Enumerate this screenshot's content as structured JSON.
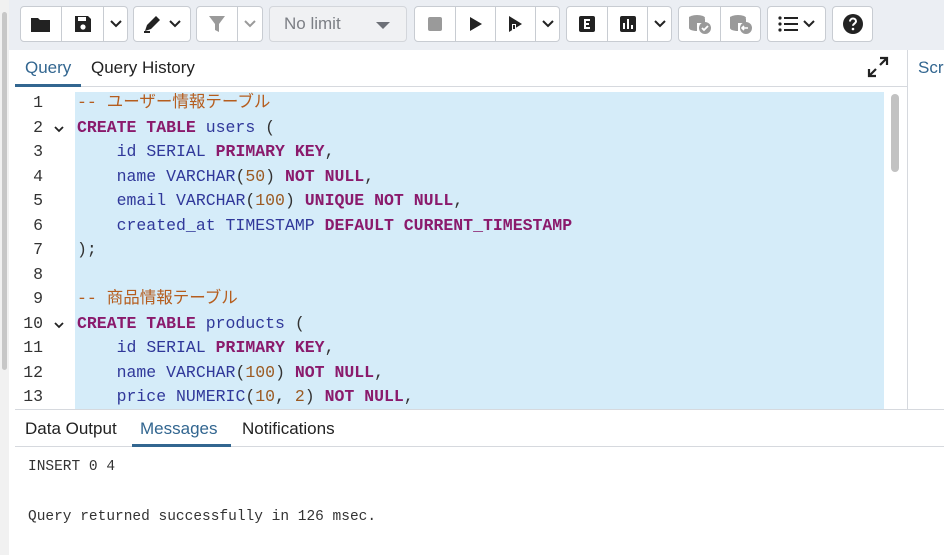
{
  "toolbar": {
    "limit_select": "No limit",
    "icons": [
      "folder-open-icon",
      "save-icon",
      "chevron-down-icon",
      "pen-icon",
      "filter-icon",
      "stop-icon",
      "play-icon",
      "play-step-icon",
      "explain-icon",
      "explain-analyze-icon",
      "commit-icon",
      "rollback-icon",
      "macros-icon",
      "help-icon"
    ]
  },
  "query_tabs": [
    {
      "label": "Query",
      "active": true
    },
    {
      "label": "Query History",
      "active": false
    }
  ],
  "right_panel_label": "Scr",
  "editor": {
    "line_numbers": [
      "1",
      "2",
      "3",
      "4",
      "5",
      "6",
      "7",
      "8",
      "9",
      "10",
      "11",
      "12",
      "13"
    ],
    "lines": [
      {
        "segments": [
          {
            "t": "-- ユーザー情報テーブル",
            "c": "cm"
          }
        ]
      },
      {
        "segments": [
          {
            "t": "CREATE TABLE",
            "c": "kw"
          },
          {
            "t": " users ",
            "c": "id"
          },
          {
            "t": "(",
            "c": "pn"
          }
        ]
      },
      {
        "segments": [
          {
            "t": "    id ",
            "c": "id"
          },
          {
            "t": "SERIAL",
            "c": "tp"
          },
          {
            "t": " ",
            "c": "pn"
          },
          {
            "t": "PRIMARY KEY",
            "c": "kw"
          },
          {
            "t": ",",
            "c": "pn"
          }
        ]
      },
      {
        "segments": [
          {
            "t": "    name ",
            "c": "id"
          },
          {
            "t": "VARCHAR",
            "c": "tp"
          },
          {
            "t": "(",
            "c": "pn"
          },
          {
            "t": "50",
            "c": "num"
          },
          {
            "t": ") ",
            "c": "pn"
          },
          {
            "t": "NOT NULL",
            "c": "kw"
          },
          {
            "t": ",",
            "c": "pn"
          }
        ]
      },
      {
        "segments": [
          {
            "t": "    email ",
            "c": "id"
          },
          {
            "t": "VARCHAR",
            "c": "tp"
          },
          {
            "t": "(",
            "c": "pn"
          },
          {
            "t": "100",
            "c": "num"
          },
          {
            "t": ") ",
            "c": "pn"
          },
          {
            "t": "UNIQUE NOT NULL",
            "c": "kw"
          },
          {
            "t": ",",
            "c": "pn"
          }
        ]
      },
      {
        "segments": [
          {
            "t": "    created_at ",
            "c": "id"
          },
          {
            "t": "TIMESTAMP",
            "c": "tp"
          },
          {
            "t": " ",
            "c": "pn"
          },
          {
            "t": "DEFAULT CURRENT_TIMESTAMP",
            "c": "kw"
          }
        ]
      },
      {
        "segments": [
          {
            "t": ");",
            "c": "pn"
          }
        ]
      },
      {
        "segments": [
          {
            "t": "",
            "c": "pn"
          }
        ]
      },
      {
        "segments": [
          {
            "t": "-- 商品情報テーブル",
            "c": "cm"
          }
        ]
      },
      {
        "segments": [
          {
            "t": "CREATE TABLE",
            "c": "kw"
          },
          {
            "t": " products ",
            "c": "id"
          },
          {
            "t": "(",
            "c": "pn"
          }
        ]
      },
      {
        "segments": [
          {
            "t": "    id ",
            "c": "id"
          },
          {
            "t": "SERIAL",
            "c": "tp"
          },
          {
            "t": " ",
            "c": "pn"
          },
          {
            "t": "PRIMARY KEY",
            "c": "kw"
          },
          {
            "t": ",",
            "c": "pn"
          }
        ]
      },
      {
        "segments": [
          {
            "t": "    name ",
            "c": "id"
          },
          {
            "t": "VARCHAR",
            "c": "tp"
          },
          {
            "t": "(",
            "c": "pn"
          },
          {
            "t": "100",
            "c": "num"
          },
          {
            "t": ") ",
            "c": "pn"
          },
          {
            "t": "NOT NULL",
            "c": "kw"
          },
          {
            "t": ",",
            "c": "pn"
          }
        ]
      },
      {
        "segments": [
          {
            "t": "    price ",
            "c": "id"
          },
          {
            "t": "NUMERIC",
            "c": "tp"
          },
          {
            "t": "(",
            "c": "pn"
          },
          {
            "t": "10",
            "c": "num"
          },
          {
            "t": ", ",
            "c": "pn"
          },
          {
            "t": "2",
            "c": "num"
          },
          {
            "t": ") ",
            "c": "pn"
          },
          {
            "t": "NOT NULL",
            "c": "kw"
          },
          {
            "t": ",",
            "c": "pn"
          }
        ]
      }
    ],
    "fold_lines": [
      2,
      10
    ]
  },
  "output_tabs": [
    {
      "label": "Data Output",
      "active": false
    },
    {
      "label": "Messages",
      "active": true
    },
    {
      "label": "Notifications",
      "active": false
    }
  ],
  "messages": {
    "line1": "INSERT 0 4",
    "line2": "Query returned successfully in 126 msec."
  },
  "colors": {
    "accent": "#326690",
    "selection": "#d5ecf9",
    "keyword": "#8a1a6c",
    "comment": "#b55d1e",
    "number": "#9b5a22"
  }
}
